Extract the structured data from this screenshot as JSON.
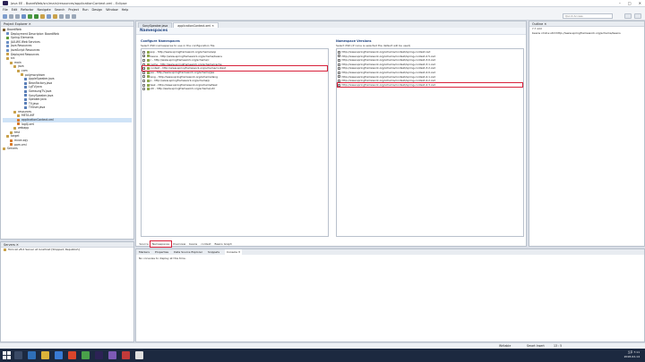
{
  "window": {
    "title": "Java EE - BoardWeb/src/main/resources/applicationContext.xml - Eclipse",
    "controls": [
      "–",
      "□",
      "✕"
    ]
  },
  "menu": [
    "File",
    "Edit",
    "Refactor",
    "Navigate",
    "Search",
    "Project",
    "Run",
    "Design",
    "Window",
    "Help"
  ],
  "toolbar": {
    "quick_access": "Quick Access"
  },
  "package_explorer": {
    "title": "Project Explorer ✕",
    "items": [
      {
        "label": "BoardWeb",
        "indent": 0,
        "color": "#7a5c2e"
      },
      {
        "label": "Deployment Descriptor: BoardWeb",
        "indent": 1,
        "color": "#6b8fc6"
      },
      {
        "label": "Spring Elements",
        "indent": 1,
        "color": "#5f9d3b"
      },
      {
        "label": "JAX-WS Web Services",
        "indent": 1,
        "color": "#6b8fc6"
      },
      {
        "label": "Java Resources",
        "indent": 1,
        "color": "#6b8fc6"
      },
      {
        "label": "JavaScript Resources",
        "indent": 1,
        "color": "#6b8fc6"
      },
      {
        "label": "Deployed Resources",
        "indent": 1,
        "color": "#c9a14a"
      },
      {
        "label": "src",
        "indent": 1,
        "color": "#c9a14a"
      },
      {
        "label": "main",
        "indent": 2,
        "color": "#c9a14a"
      },
      {
        "label": "java",
        "indent": 3,
        "color": "#c9a14a"
      },
      {
        "label": "com",
        "indent": 4,
        "color": "#c9a14a"
      },
      {
        "label": "polymorphism",
        "indent": 5,
        "color": "#c9a14a"
      },
      {
        "label": "AppleSpeaker.java",
        "indent": 6,
        "color": "#5a7fb8"
      },
      {
        "label": "BeanFactory.java",
        "indent": 6,
        "color": "#5a7fb8"
      },
      {
        "label": "LgTV.java",
        "indent": 6,
        "color": "#5a7fb8"
      },
      {
        "label": "SamsungTV.java",
        "indent": 6,
        "color": "#5a7fb8"
      },
      {
        "label": "SonySpeaker.java",
        "indent": 6,
        "color": "#5a7fb8"
      },
      {
        "label": "Speaker.java",
        "indent": 6,
        "color": "#5a7fb8"
      },
      {
        "label": "TV.java",
        "indent": 6,
        "color": "#5a7fb8"
      },
      {
        "label": "TVUser.java",
        "indent": 6,
        "color": "#5a7fb8"
      },
      {
        "label": "resources",
        "indent": 3,
        "color": "#c9a14a"
      },
      {
        "label": "META-INF",
        "indent": 4,
        "color": "#c9a14a"
      },
      {
        "label": "applicationContext.xml",
        "indent": 4,
        "color": "#d97a2a",
        "selected": true
      },
      {
        "label": "log4j.xml",
        "indent": 4,
        "color": "#d97a2a"
      },
      {
        "label": "webapp",
        "indent": 3,
        "color": "#c9a14a"
      },
      {
        "label": "test",
        "indent": 2,
        "color": "#c9a14a"
      },
      {
        "label": "target",
        "indent": 1,
        "color": "#c9a14a"
      },
      {
        "label": "mvce.xqy",
        "indent": 2,
        "color": "#d97a2a"
      },
      {
        "label": "pom.xml",
        "indent": 2,
        "color": "#d97a2a"
      },
      {
        "label": "Servers",
        "indent": 0,
        "color": "#c9a14a"
      }
    ]
  },
  "editor": {
    "tabs": [
      {
        "label": "SonySpeaker.java",
        "active": false
      },
      {
        "label": "applicationContext.xml ✕",
        "active": true
      }
    ],
    "heading": "Namespaces",
    "configure": {
      "title": "Configure Namespaces",
      "desc": "Select XSD namespaces to use in the configuration file",
      "items": [
        {
          "checked": false,
          "label": "aop - http://www.springframework.org/schema/aop"
        },
        {
          "checked": true,
          "label": "beans - http://www.springframework.org/schema/beans"
        },
        {
          "checked": false,
          "label": "c - http://www.springframework.org/schema/c"
        },
        {
          "checked": false,
          "label": "cache - http://www.springframework.org/schema/cache"
        },
        {
          "checked": true,
          "label": "context - http://www.springframework.org/schema/context",
          "highlight": true
        },
        {
          "checked": false,
          "label": "jee - http://www.springframework.org/schema/jee"
        },
        {
          "checked": false,
          "label": "lang - http://www.springframework.org/schema/lang"
        },
        {
          "checked": false,
          "label": "p - http://www.springframework.org/schema/p"
        },
        {
          "checked": false,
          "label": "task - http://www.springframework.org/schema/task"
        },
        {
          "checked": false,
          "label": "util - http://www.springframework.org/schema/util"
        }
      ]
    },
    "versions": {
      "title": "Namespace Versions",
      "desc": "Select XSD (if none is selected the default will be used)",
      "items": [
        {
          "checked": false,
          "label": "http://www.springframework.org/schema/context/spring-context.xsd"
        },
        {
          "checked": false,
          "label": "http://www.springframework.org/schema/context/spring-context-2.5.xsd"
        },
        {
          "checked": false,
          "label": "http://www.springframework.org/schema/context/spring-context-3.0.xsd"
        },
        {
          "checked": false,
          "label": "http://www.springframework.org/schema/context/spring-context-3.1.xsd"
        },
        {
          "checked": false,
          "label": "http://www.springframework.org/schema/context/spring-context-3.2.xsd"
        },
        {
          "checked": false,
          "label": "http://www.springframework.org/schema/context/spring-context-4.0.xsd"
        },
        {
          "checked": false,
          "label": "http://www.springframework.org/schema/context/spring-context-4.1.xsd"
        },
        {
          "checked": false,
          "label": "http://www.springframework.org/schema/context/spring-context-4.2.xsd"
        },
        {
          "checked": false,
          "label": "http://www.springframework.org/schema/context/spring-context-4.3.xsd",
          "highlight": true
        }
      ]
    },
    "bottom_tabs": [
      {
        "label": "Source",
        "active": false
      },
      {
        "label": "Namespaces",
        "active": true
      },
      {
        "label": "Overview",
        "active": false
      },
      {
        "label": "beans",
        "active": false
      },
      {
        "label": "context",
        "active": false
      },
      {
        "label": "Beans Graph",
        "active": false
      }
    ]
  },
  "outline": {
    "title": "Outline ✕",
    "rows": [
      "?-? xml",
      "beans xmlns:util=http://www.springframework.org/schema/beans"
    ]
  },
  "servers": {
    "title": "Servers ✕",
    "rows": [
      "Tomcat v8.0 Server at localhost  [Stopped, Republish]"
    ]
  },
  "console": {
    "tabs": [
      "Markers",
      "Properties",
      "Data Source Explorer",
      "Snippets",
      "Console ✕"
    ],
    "message": "No consoles to display at this time."
  },
  "status": {
    "writable": "Writable",
    "insert": "Smart Insert",
    "position": "13 : 5"
  },
  "taskbar": {
    "time": "오후 7:11",
    "date": "2018-02-14"
  },
  "colors": {
    "accent": "#2a4c86",
    "highlight": "#d8203a",
    "taskbar": "#1c2940"
  }
}
